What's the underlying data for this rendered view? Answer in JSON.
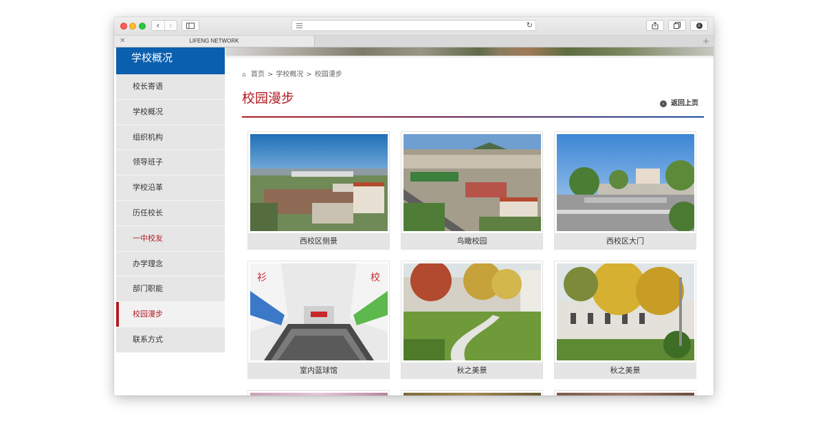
{
  "browser": {
    "tab_title": "LIFENG NETWORK",
    "icons": [
      "close-icon",
      "back-icon",
      "forward-icon",
      "sidebar-icon",
      "reader-icon",
      "reload-icon",
      "share-icon",
      "tabs-icon",
      "download-icon",
      "new-tab-icon"
    ]
  },
  "sidebar": {
    "title": "学校概况",
    "items": [
      {
        "label": "校长寄语"
      },
      {
        "label": "学校概况"
      },
      {
        "label": "组织机构"
      },
      {
        "label": "领导班子"
      },
      {
        "label": "学校沿革"
      },
      {
        "label": "历任校长"
      },
      {
        "label": "一中校友"
      },
      {
        "label": "办学理念"
      },
      {
        "label": "部门职能"
      },
      {
        "label": "校园漫步"
      },
      {
        "label": "联系方式"
      }
    ],
    "active_item": "校园漫步"
  },
  "breadcrumb": {
    "home": "首页",
    "section": "学校概况",
    "current": "校园漫步",
    "separator": ">"
  },
  "main": {
    "title": "校园漫步",
    "back_label": "返回上页"
  },
  "gallery": [
    {
      "caption": "西校区侧景"
    },
    {
      "caption": "鸟瞰校园"
    },
    {
      "caption": "西校区大门"
    },
    {
      "caption": "室内蓝球馆"
    },
    {
      "caption": "秋之美景"
    },
    {
      "caption": "秋之美景"
    }
  ],
  "colors": {
    "accent_red": "#b01b22",
    "sidebar_blue": "#0a5fae",
    "rule_blue": "#1a4f9c"
  }
}
